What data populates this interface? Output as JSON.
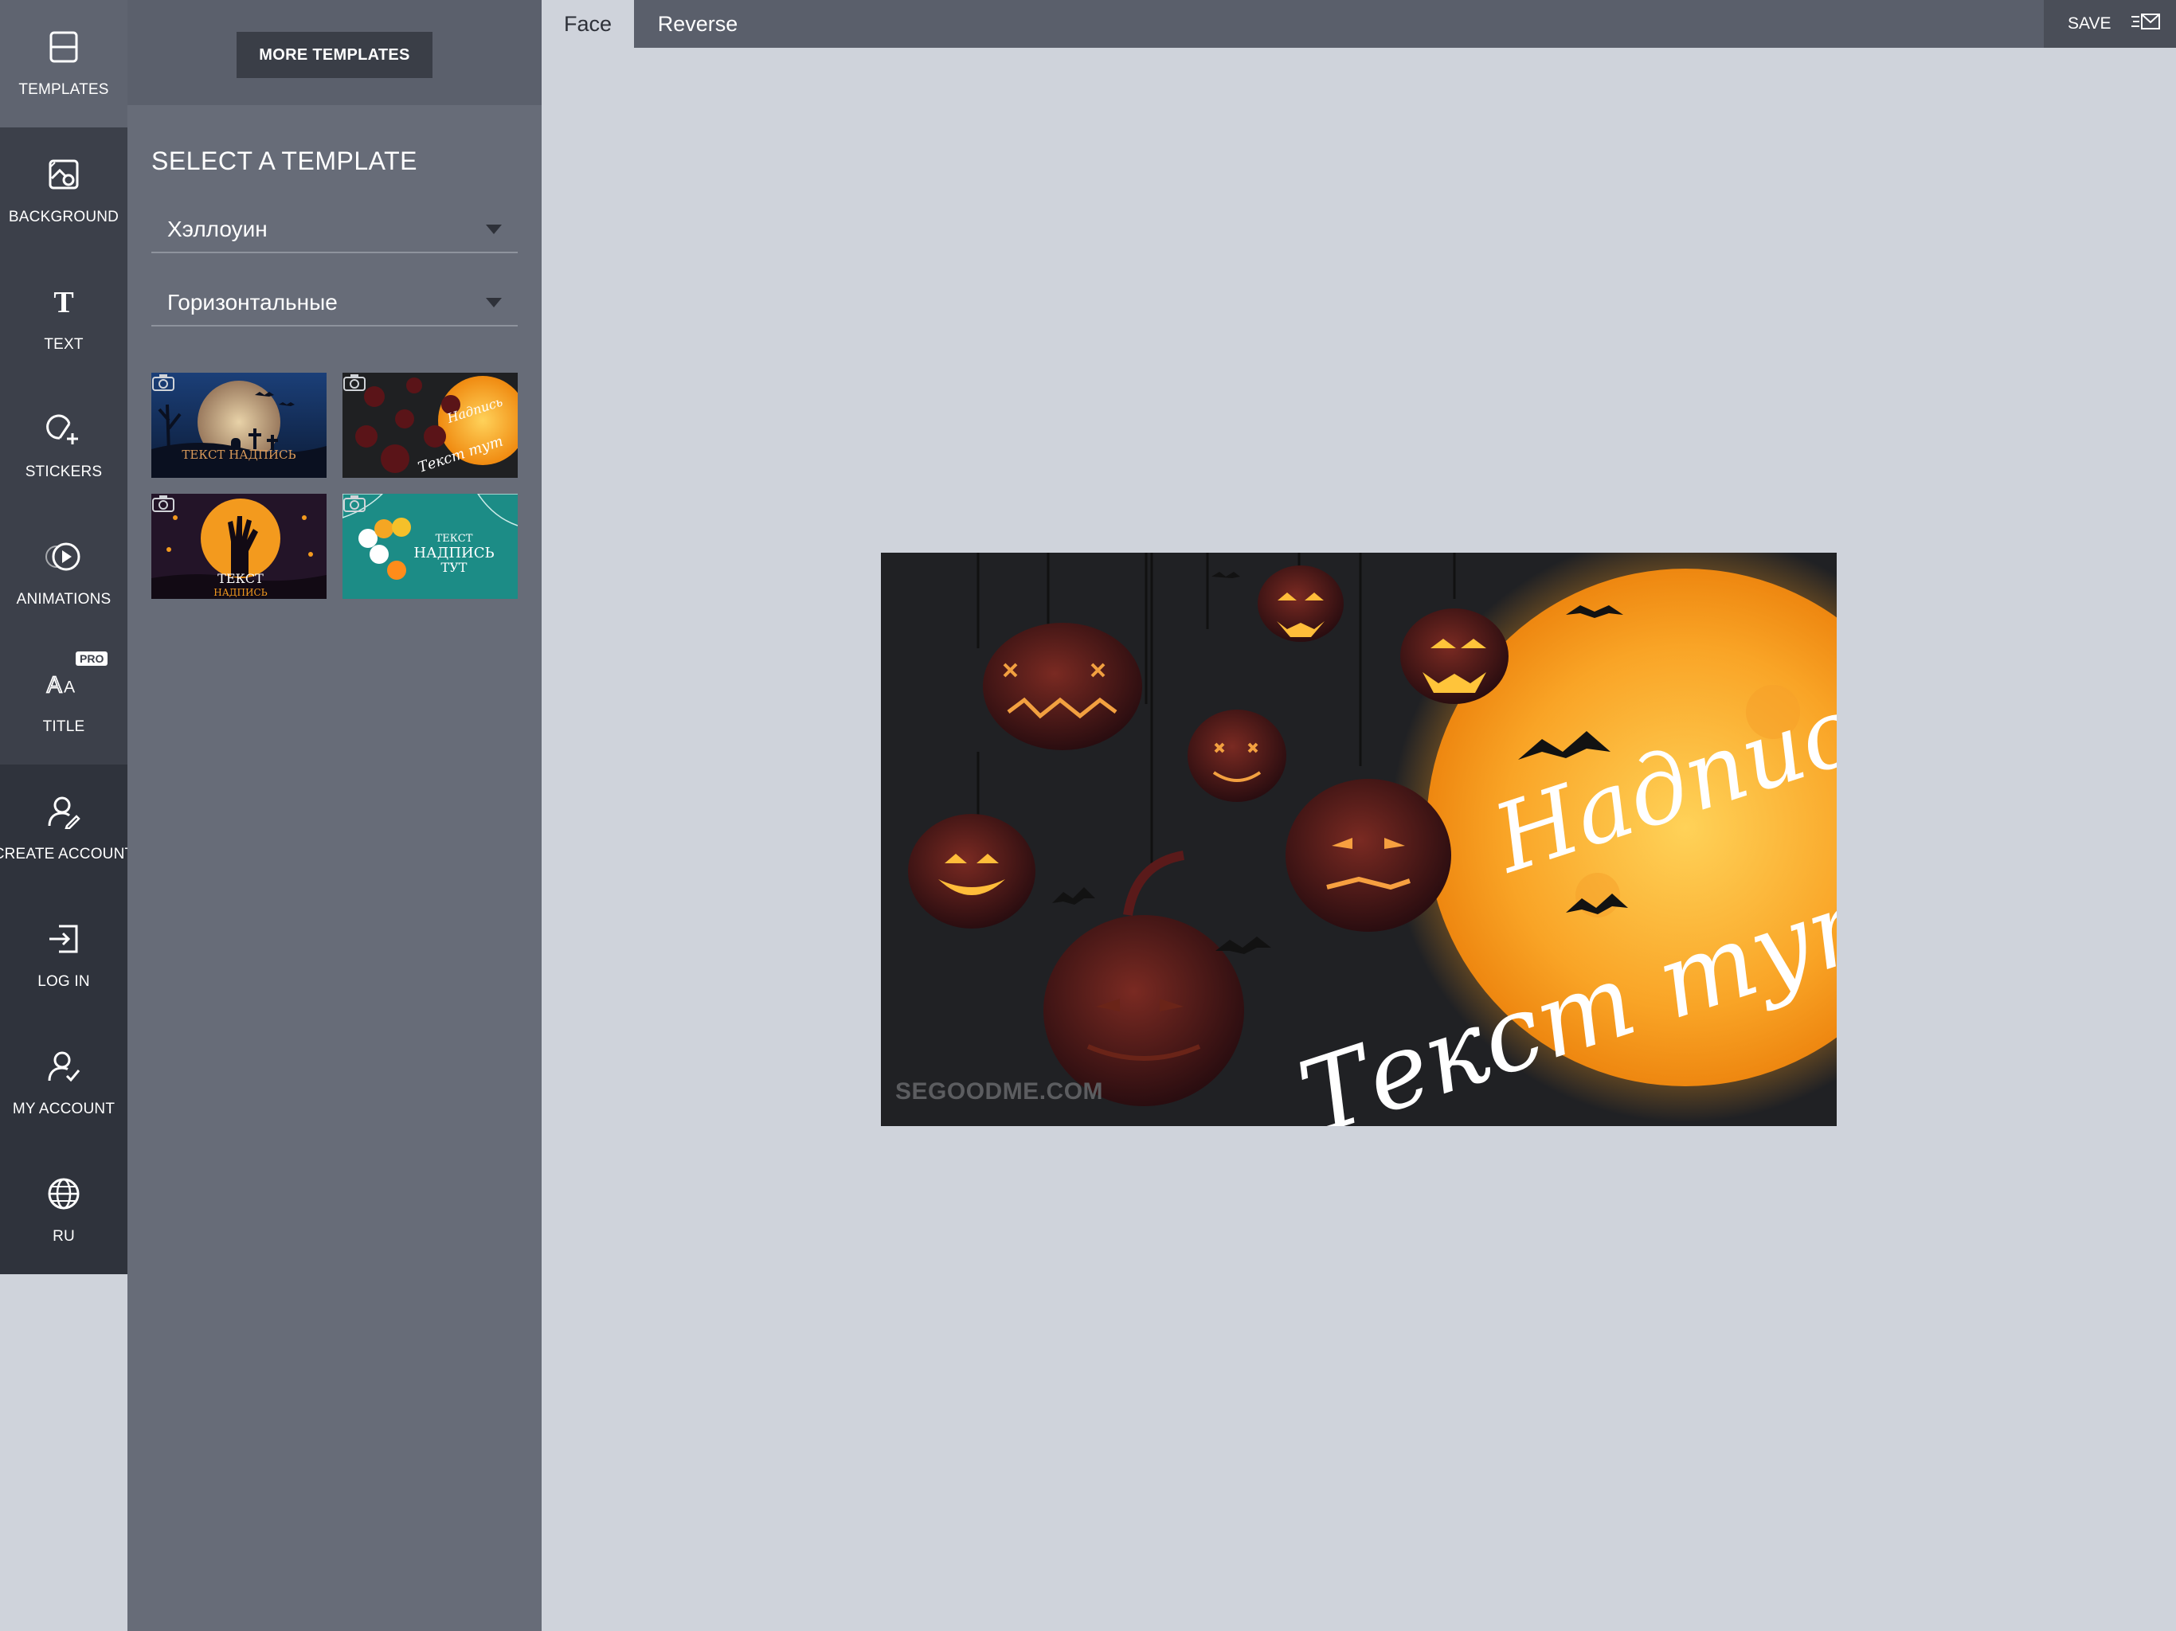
{
  "rail": {
    "items": [
      {
        "label": "TEMPLATES",
        "icon": "template-icon"
      },
      {
        "label": "BACKGROUND",
        "icon": "background-icon"
      },
      {
        "label": "TEXT",
        "icon": "text-icon"
      },
      {
        "label": "STICKERS",
        "icon": "sticker-icon"
      },
      {
        "label": "ANIMATIONS",
        "icon": "animation-icon"
      },
      {
        "label": "TITLE",
        "icon": "title-icon",
        "badge": "PRO"
      },
      {
        "label": "CREATE ACCOUNT",
        "icon": "create-account-icon"
      },
      {
        "label": "LOG IN",
        "icon": "login-icon"
      },
      {
        "label": "MY ACCOUNT",
        "icon": "account-icon"
      },
      {
        "label": "RU",
        "icon": "globe-icon"
      }
    ]
  },
  "panel": {
    "more_templates": "MORE TEMPLATES",
    "title": "SELECT A TEMPLATE",
    "category_select": "Хэллоуин",
    "format_select": "Горизонтальные",
    "thumbnails": [
      {
        "text": "ТЕКСТ НАДПИСЬ",
        "icon": "camera-icon"
      },
      {
        "text": "Надпись Текст тут",
        "icon": "camera-icon"
      },
      {
        "text": "ТЕКСТ НАДПИСЬ",
        "icon": "camera-icon"
      },
      {
        "text": "ТЕКСТ НАДПИСЬ ТУТ",
        "icon": "camera-icon"
      }
    ]
  },
  "topbar": {
    "tab_face": "Face",
    "tab_reverse": "Reverse",
    "save": "SAVE"
  },
  "card": {
    "line1": "Надпись",
    "line2": "Текст тут",
    "watermark": "SEGOODME.COM"
  },
  "colors": {
    "rail_bg": "#3c404a",
    "panel_bg": "#676c78",
    "canvas_bg": "#cfd3db",
    "moon": "#f7a21f"
  }
}
